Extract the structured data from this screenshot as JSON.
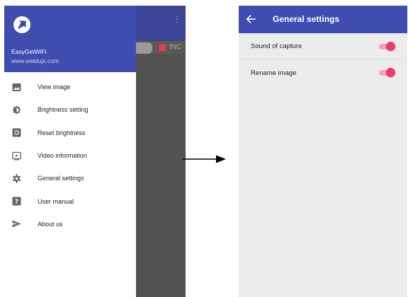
{
  "drawer": {
    "app_name": "EasyGetWiFi",
    "website": "www.weidujs.com",
    "items": [
      {
        "label": "View image",
        "icon": "image-icon"
      },
      {
        "label": "Brightness setting",
        "icon": "brightness-icon"
      },
      {
        "label": "Reset brightness",
        "icon": "reset-icon"
      },
      {
        "label": "Video information",
        "icon": "video-icon"
      },
      {
        "label": "General settings",
        "icon": "gear-icon"
      },
      {
        "label": "User manual",
        "icon": "help-icon"
      },
      {
        "label": "About us",
        "icon": "send-icon"
      }
    ]
  },
  "background": {
    "toolbar_label": "INC"
  },
  "settings": {
    "title": "General settings",
    "rows": [
      {
        "label": "Sound of capture",
        "on": true
      },
      {
        "label": "Rename image",
        "on": true
      }
    ]
  },
  "colors": {
    "primary": "#3f4db1",
    "accent": "#f0386b",
    "accent_track": "#f3a3bb",
    "screen_bg": "#ececec",
    "dim_overlay": "#525252"
  }
}
